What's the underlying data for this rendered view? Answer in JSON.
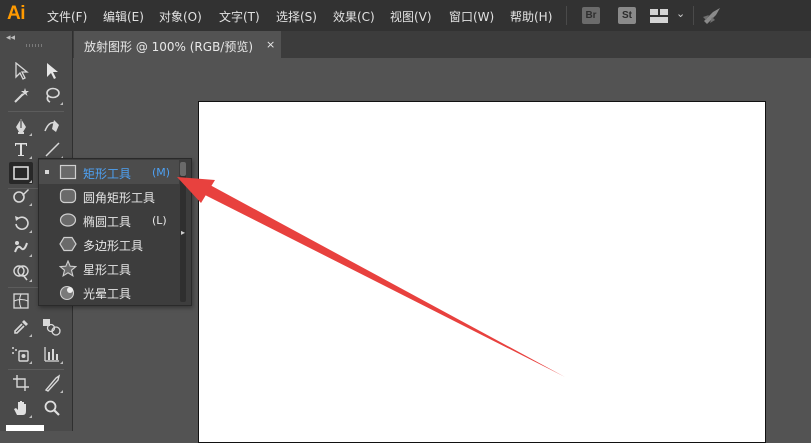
{
  "app": {
    "logo": "Ai",
    "menu": [
      "文件(F)",
      "编辑(E)",
      "对象(O)",
      "文字(T)",
      "选择(S)",
      "效果(C)",
      "视图(V)",
      "窗口(W)",
      "帮助(H)"
    ],
    "bridge_badge": "Br",
    "stock_badge": "St",
    "workspace_icon": "workspace-grid-icon",
    "sync_icon": "rocket-icon"
  },
  "document": {
    "tab_title": "放射图形 @ 100% (RGB/预览)",
    "close_glyph": "×"
  },
  "toolbar": {
    "collapse_glyph": "◂◂",
    "tools": [
      "selection-tool",
      "direct-selection-tool",
      "magic-wand-tool",
      "lasso-tool",
      "pen-tool",
      "curvature-tool",
      "type-tool",
      "line-segment-tool",
      "rectangle-tool",
      "paintbrush-tool",
      "shaper-tool",
      "eraser-tool",
      "rotate-tool",
      "scale-tool",
      "warp-tool",
      "free-transform-tool",
      "shape-builder-tool",
      "perspective-grid-tool",
      "mesh-tool",
      "gradient-tool",
      "eyedropper-tool",
      "blend-tool",
      "symbol-sprayer-tool",
      "column-graph-tool",
      "artboard-tool",
      "slice-tool",
      "hand-tool",
      "zoom-tool"
    ]
  },
  "flyout": {
    "items": [
      {
        "label": "矩形工具",
        "key": "(M)",
        "icon": "rectangle-icon",
        "current": true
      },
      {
        "label": "圆角矩形工具",
        "key": "",
        "icon": "rounded-rectangle-icon",
        "current": false
      },
      {
        "label": "椭圆工具",
        "key": "(L)",
        "icon": "ellipse-icon",
        "current": false
      },
      {
        "label": "多边形工具",
        "key": "",
        "icon": "polygon-icon",
        "current": false
      },
      {
        "label": "星形工具",
        "key": "",
        "icon": "star-icon",
        "current": false
      },
      {
        "label": "光晕工具",
        "key": "",
        "icon": "flare-icon",
        "current": false
      }
    ]
  },
  "colors": {
    "accent": "#4ea1f3",
    "annotation_arrow": "#e8413e",
    "logo": "#ff9a00"
  }
}
